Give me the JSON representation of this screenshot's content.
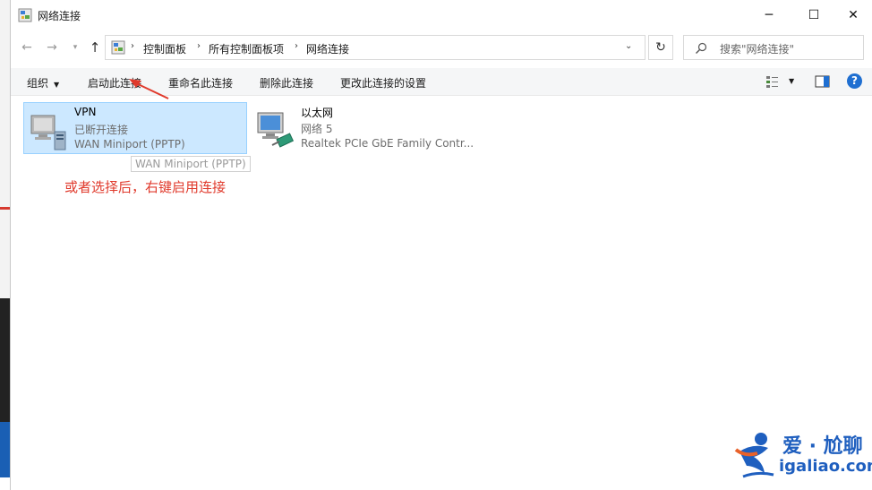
{
  "window": {
    "title": "网络连接",
    "controls": {
      "minimize": "─",
      "maximize": "☐",
      "close": "✕"
    }
  },
  "nav": {
    "back": "←",
    "forward": "→",
    "recent": "▾",
    "up": "↑",
    "breadcrumbs": [
      "控制面板",
      "所有控制面板项",
      "网络连接"
    ],
    "crumb_separator": "›",
    "dropdown": "⌄",
    "refresh": "↻",
    "search_placeholder": "搜索\"网络连接\""
  },
  "toolbar": {
    "organize": "组织",
    "organize_arrow": "▼",
    "start": "启动此连接",
    "rename": "重命名此连接",
    "delete": "删除此连接",
    "change": "更改此连接的设置",
    "view_arrow": "▼",
    "help": "?"
  },
  "connections": [
    {
      "name": "VPN",
      "status": "已断开连接",
      "device": "WAN Miniport (PPTP)",
      "selected": true
    },
    {
      "name": "以太网",
      "status": "网络 5",
      "device": "Realtek PCIe GbE Family Contr..."
    }
  ],
  "tooltip": "WAN Miniport (PPTP)",
  "annotation": "或者选择后，右键启用连接",
  "watermark": {
    "top": "爱 · 尬聊",
    "bottom": "igaliao.com"
  },
  "colors": {
    "selection": "#cce8ff",
    "selection_border": "#99d1ff",
    "annotation": "#e03a2c",
    "watermark": "#1f5fbf",
    "help": "#1f6fd1"
  }
}
